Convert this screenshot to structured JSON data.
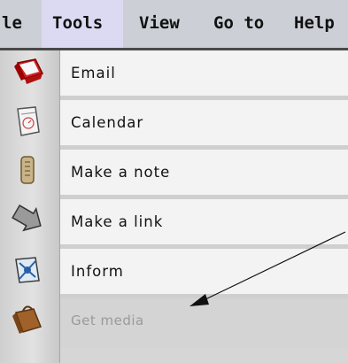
{
  "menubar": {
    "items": [
      {
        "label": "le"
      },
      {
        "label": "Tools"
      },
      {
        "label": "View"
      },
      {
        "label": "Go to"
      },
      {
        "label": "Help"
      }
    ]
  },
  "tools_menu": {
    "items": [
      {
        "label": "Email",
        "icon": "envelope-icon"
      },
      {
        "label": "Calendar",
        "icon": "calendar-icon"
      },
      {
        "label": "Make a note",
        "icon": "note-icon"
      },
      {
        "label": "Make a link",
        "icon": "link-arrow-icon"
      },
      {
        "label": "Inform",
        "icon": "inform-icon"
      },
      {
        "label": "Get media",
        "icon": "media-bag-icon",
        "disabled": true
      }
    ]
  }
}
